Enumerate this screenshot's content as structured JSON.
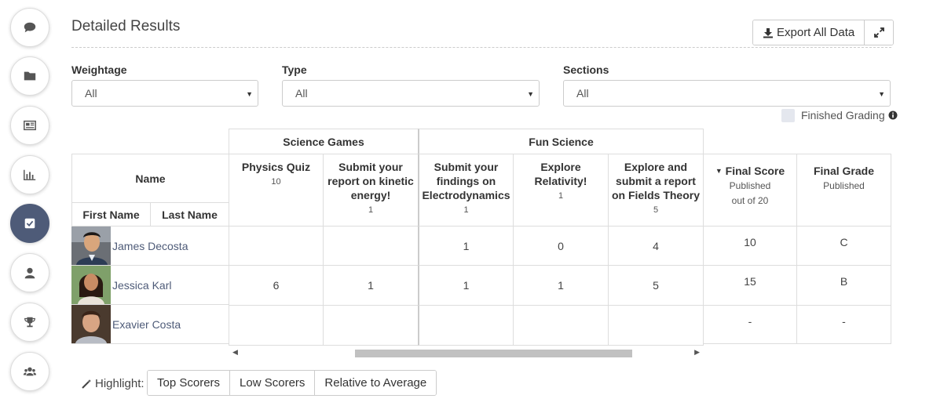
{
  "page": {
    "title": "Detailed Results",
    "export_label": "Export All Data"
  },
  "filters": {
    "weightage": {
      "label": "Weightage",
      "value": "All"
    },
    "type": {
      "label": "Type",
      "value": "All"
    },
    "sections": {
      "label": "Sections",
      "value": "All"
    }
  },
  "legend": {
    "finished_grading": "Finished Grading"
  },
  "table": {
    "name_header": "Name",
    "first_name_header": "First Name",
    "last_name_header": "Last Name",
    "groups": [
      "Science Games",
      "Fun Science"
    ],
    "columns": [
      {
        "title": "Physics Quiz",
        "sub": "10"
      },
      {
        "title": "Submit your report on kinetic energy!",
        "sub": "1"
      },
      {
        "title": "Submit your findings on Electrodynamics",
        "sub": "1"
      },
      {
        "title": "Explore Relativity!",
        "sub": "1"
      },
      {
        "title": "Explore and submit a report on Fields Theory",
        "sub": "5"
      }
    ],
    "final_score": {
      "title": "Final Score",
      "sub1": "Published",
      "sub2": "out of 20"
    },
    "final_grade": {
      "title": "Final Grade",
      "sub1": "Published"
    },
    "students": [
      {
        "name": "James Decosta",
        "scores": [
          "",
          "",
          "1",
          "0",
          "4"
        ],
        "final": "10",
        "grade": "C"
      },
      {
        "name": "Jessica Karl",
        "scores": [
          "6",
          "1",
          "1",
          "1",
          "5"
        ],
        "final": "15",
        "grade": "B"
      },
      {
        "name": "Exavier Costa",
        "scores": [
          "",
          "",
          "",
          "",
          ""
        ],
        "final": "-",
        "grade": "-"
      }
    ]
  },
  "highlight": {
    "label": "Highlight:",
    "options": [
      "Top Scorers",
      "Low Scorers",
      "Relative to Average"
    ]
  },
  "icons": {
    "sidebar": [
      "comment-icon",
      "folder-icon",
      "newspaper-icon",
      "bar-chart-icon",
      "check-square-icon",
      "user-icon",
      "trophy-icon",
      "users-icon"
    ],
    "active_index": 4
  },
  "colors": {
    "accent": "#4e5b78",
    "grading_box": "#e4e7ee"
  }
}
